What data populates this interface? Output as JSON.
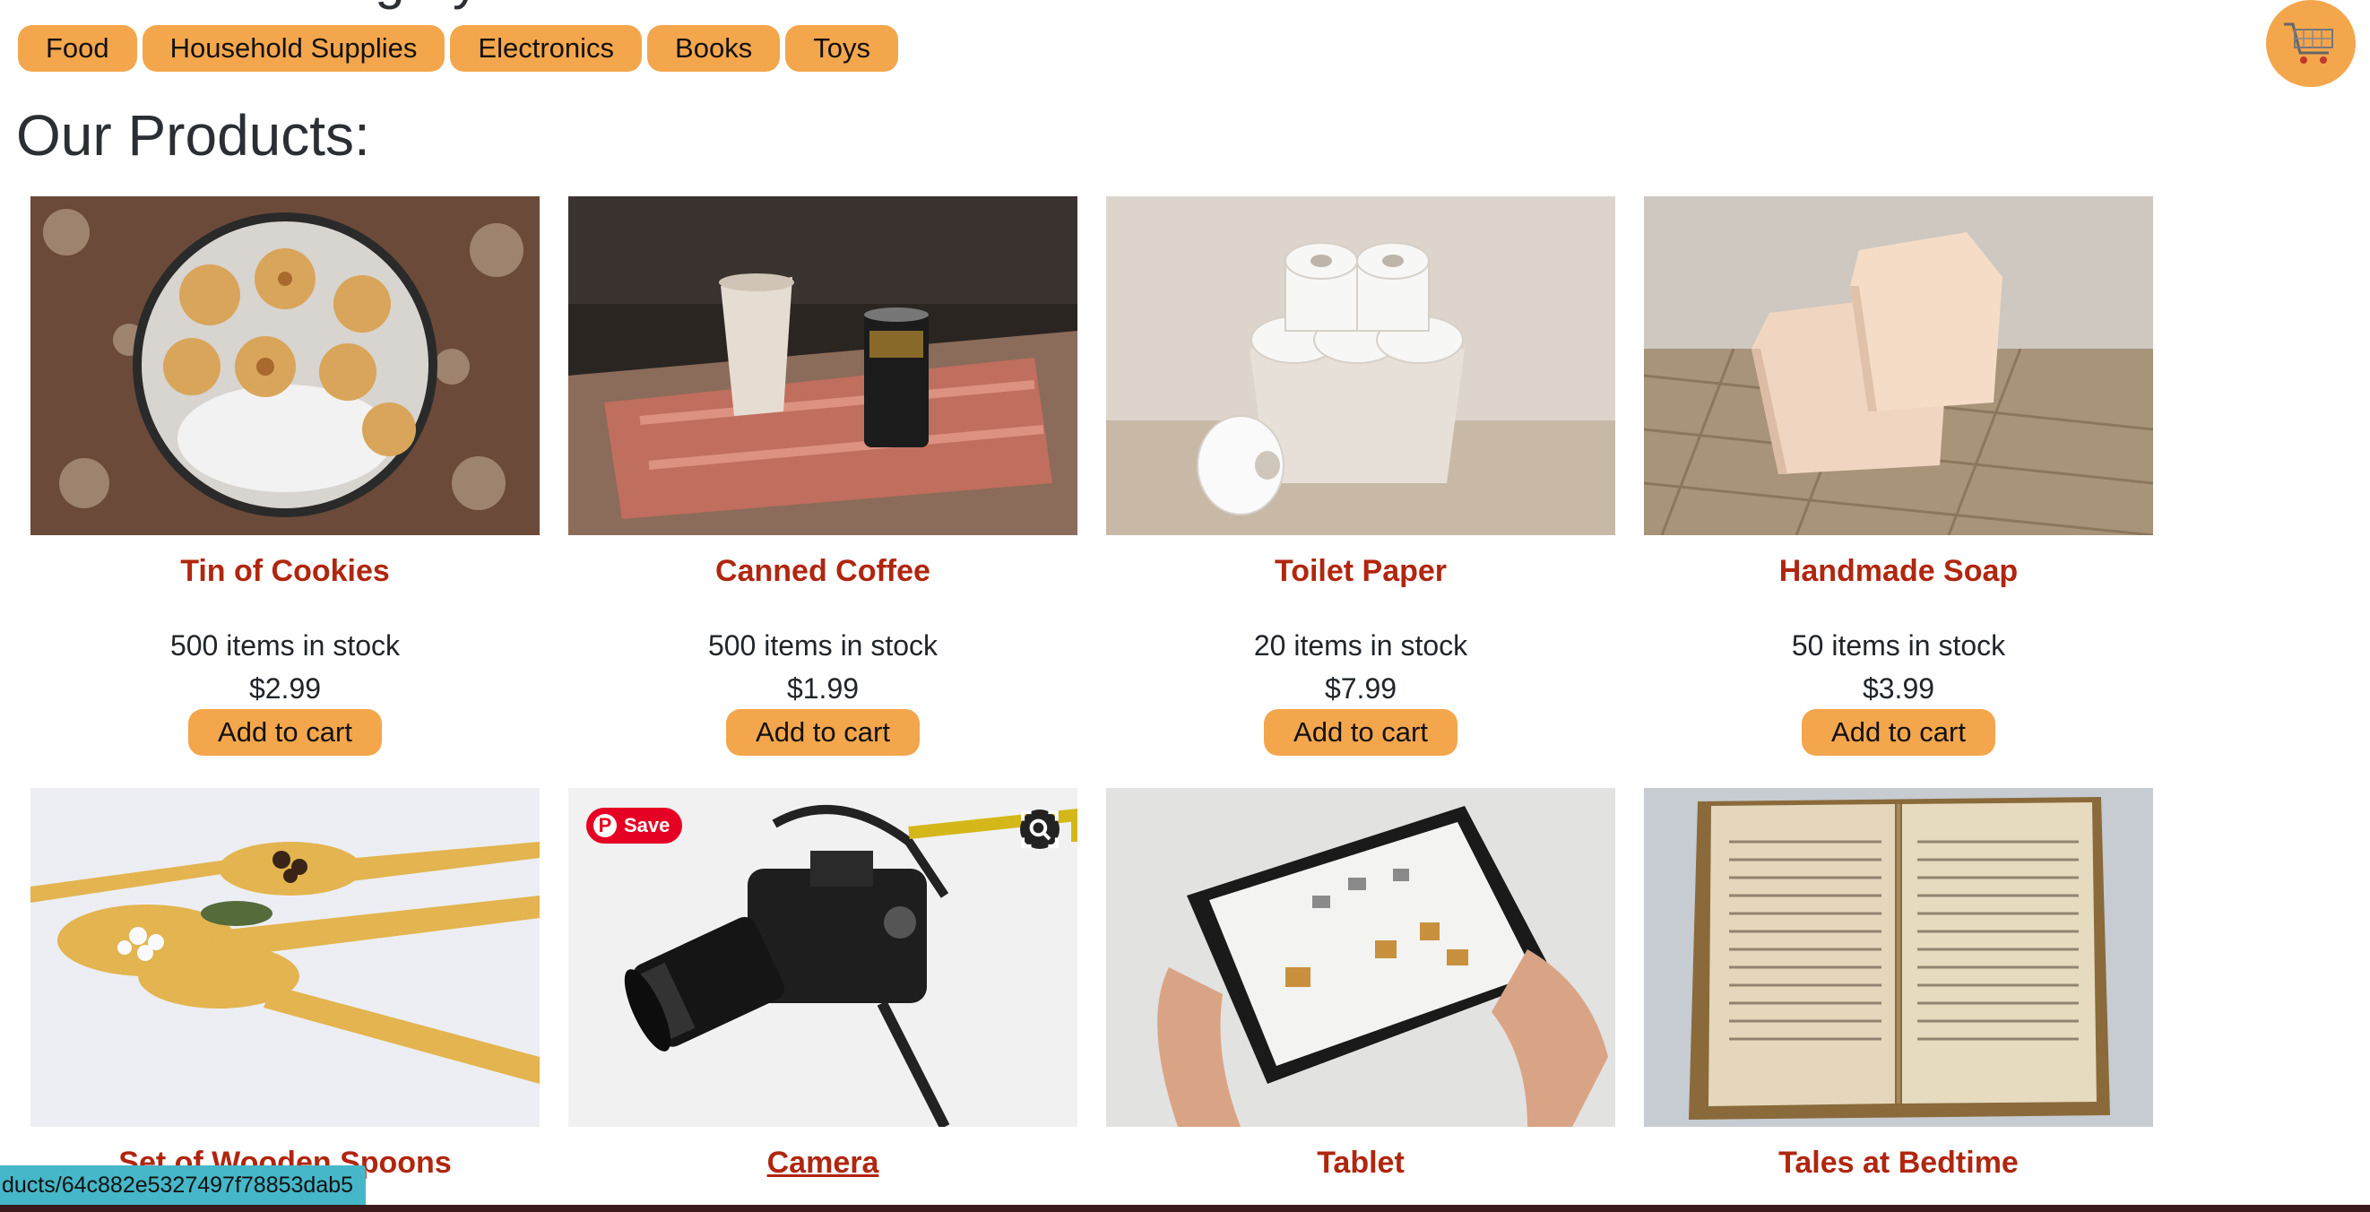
{
  "heading_cut": "Choose a Category",
  "categories": [
    "Food",
    "Household Supplies",
    "Electronics",
    "Books",
    "Toys"
  ],
  "section_title": "Our Products:",
  "add_label": "Add to cart",
  "products": [
    {
      "name": "Tin of Cookies",
      "stock": "500 items in stock",
      "price": "$2.99"
    },
    {
      "name": "Canned Coffee",
      "stock": "500 items in stock",
      "price": "$1.99"
    },
    {
      "name": "Toilet Paper",
      "stock": "20 items in stock",
      "price": "$7.99"
    },
    {
      "name": "Handmade Soap",
      "stock": "50 items in stock",
      "price": "$3.99"
    },
    {
      "name": "Set of Wooden Spoons"
    },
    {
      "name": "Camera"
    },
    {
      "name": "Tablet"
    },
    {
      "name": "Tales at Bedtime"
    }
  ],
  "overlay": {
    "save_label": "Save",
    "pin_letter": "P"
  },
  "status_url": "ducts/64c882e5327497f78853dab5",
  "colors": {
    "accent": "#f4a64d",
    "product_name": "#b0260f",
    "status_bg": "#45b7c8"
  },
  "icons": {
    "cart": "shopping-cart-icon",
    "lens": "visual-search-icon"
  }
}
